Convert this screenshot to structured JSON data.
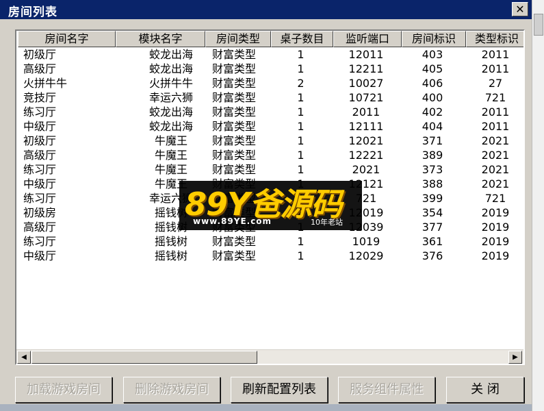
{
  "window": {
    "title": "房间列表",
    "close_glyph": "✕"
  },
  "columns": [
    "房间名字",
    "模块名字",
    "房间类型",
    "桌子数目",
    "监听端口",
    "房间标识",
    "类型标识"
  ],
  "rows": [
    [
      "初级厅",
      "蛟龙出海",
      "财富类型",
      "1",
      "12011",
      "403",
      "2011"
    ],
    [
      "高级厅",
      "蛟龙出海",
      "财富类型",
      "1",
      "12211",
      "405",
      "2011"
    ],
    [
      "火拼牛牛",
      "火拼牛牛",
      "财富类型",
      "2",
      "10027",
      "406",
      "27"
    ],
    [
      "竞技厅",
      "幸运六狮",
      "财富类型",
      "1",
      "10721",
      "400",
      "721"
    ],
    [
      "练习厅",
      "蛟龙出海",
      "财富类型",
      "1",
      "2011",
      "402",
      "2011"
    ],
    [
      "中级厅",
      "蛟龙出海",
      "财富类型",
      "1",
      "12111",
      "404",
      "2011"
    ],
    [
      "初级厅",
      "牛魔王",
      "财富类型",
      "1",
      "12021",
      "371",
      "2021"
    ],
    [
      "高级厅",
      "牛魔王",
      "财富类型",
      "1",
      "12221",
      "389",
      "2021"
    ],
    [
      "练习厅",
      "牛魔王",
      "财富类型",
      "1",
      "2021",
      "373",
      "2021"
    ],
    [
      "中级厅",
      "牛魔王",
      "财富类型",
      "1",
      "12121",
      "388",
      "2021"
    ],
    [
      "练习厅",
      "幸运六狮",
      "财富类型",
      "1",
      "721",
      "399",
      "721"
    ],
    [
      "初级房",
      "摇钱树",
      "财富类型",
      "1",
      "12019",
      "354",
      "2019"
    ],
    [
      "高级厅",
      "摇钱树",
      "财富类型",
      "1",
      "12039",
      "377",
      "2019"
    ],
    [
      "练习厅",
      "摇钱树",
      "财富类型",
      "1",
      "1019",
      "361",
      "2019"
    ],
    [
      "中级厅",
      "摇钱树",
      "财富类型",
      "1",
      "12029",
      "376",
      "2019"
    ]
  ],
  "scroll": {
    "left_glyph": "◀",
    "right_glyph": "▶"
  },
  "buttons": [
    {
      "label": "加载游戏房间",
      "enabled": false
    },
    {
      "label": "删除游戏房间",
      "enabled": false
    },
    {
      "label": "刷新配置列表",
      "enabled": true
    },
    {
      "label": "服务组件属性",
      "enabled": false
    },
    {
      "label": "关 闭",
      "enabled": true
    }
  ],
  "watermark": {
    "logo": "89Y爸源码",
    "url": "www.89YE.com",
    "tagline": "10年老站"
  }
}
